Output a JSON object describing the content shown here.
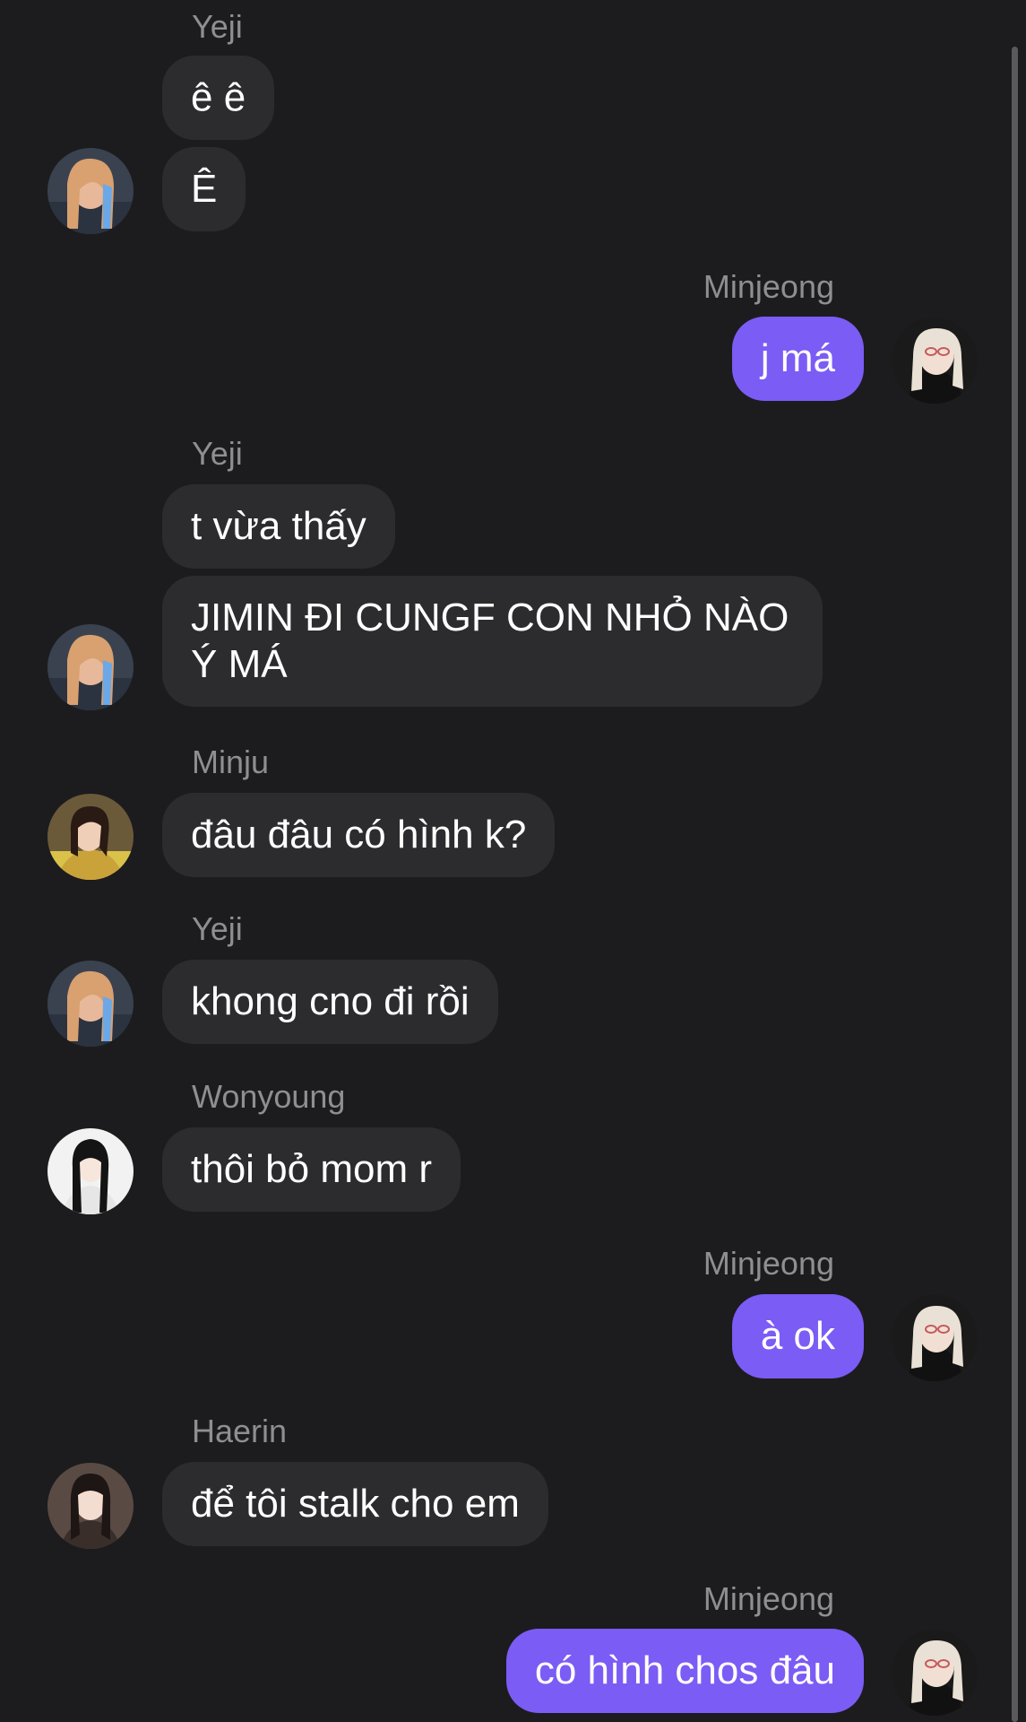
{
  "colors": {
    "background": "#1c1c1e",
    "incoming_bubble": "#2c2c2e",
    "outgoing_bubble": "#7b5cf5",
    "sender_name": "#8e8e93",
    "text": "#ffffff"
  },
  "messages": [
    {
      "sender": "Yeji",
      "text": "ê ê"
    },
    {
      "sender": "",
      "text": "Ê"
    },
    {
      "sender": "Minjeong",
      "text": "j má"
    },
    {
      "sender": "Yeji",
      "text": "t vừa thấy"
    },
    {
      "sender": "",
      "text": "JIMIN ĐI CUNGF CON NHỎ NÀO Ý MÁ"
    },
    {
      "sender": "Minju",
      "text": "đâu đâu có hình k?"
    },
    {
      "sender": "Yeji",
      "text": "khong cno đi rồi"
    },
    {
      "sender": "Wonyoung",
      "text": "thôi bỏ mom r"
    },
    {
      "sender": "Minjeong",
      "text": "à ok"
    },
    {
      "sender": "Haerin",
      "text": "để tôi stalk cho em"
    },
    {
      "sender": "Minjeong",
      "text": "có hình chos đâu"
    }
  ],
  "avatars": {
    "yeji": "avatar-yeji",
    "minjeong": "avatar-minjeong",
    "minju": "avatar-minju",
    "wonyoung": "avatar-wonyoung",
    "haerin": "avatar-haerin"
  }
}
